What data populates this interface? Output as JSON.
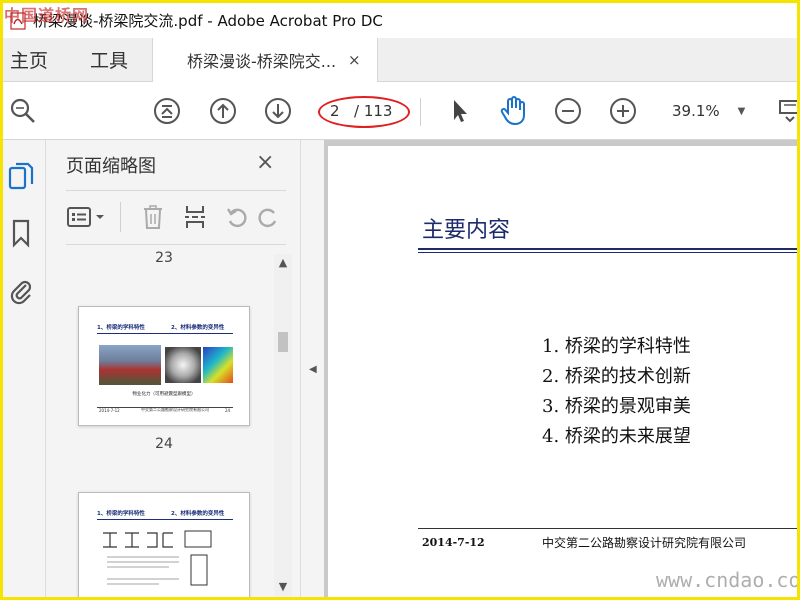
{
  "window": {
    "title": "桥梁漫谈-桥梁院交流.pdf - Adobe Acrobat Pro DC",
    "watermark_top": "中国道桥网"
  },
  "menu": {
    "home": "主页",
    "tools": "工具"
  },
  "tab": {
    "label": "桥梁漫谈-桥梁院交...",
    "close": "×"
  },
  "toolbar": {
    "page_current": "2",
    "page_total": "/ 113",
    "zoom": "39.1%"
  },
  "panel": {
    "title": "页面缩略图",
    "close": "×",
    "thumbs": [
      {
        "page_label": "23"
      },
      {
        "page_label": "24",
        "head_left": "1、桥梁的学科特性",
        "head_right": "2、材料参数的变异性",
        "caption": "物业化力（可用避震型跟模型）",
        "foot_left": "2014-7-12",
        "foot_center": "中交第二公路勘察设计研究院有限公司",
        "foot_right": "24"
      },
      {
        "head_left": "1、桥梁的学科特性",
        "head_right": "2、材料参数的变异性"
      }
    ]
  },
  "document": {
    "heading": "主要内容",
    "items": [
      "1. 桥梁的学科特性",
      "2. 桥梁的技术创新",
      "3. 桥梁的景观审美",
      "4. 桥梁的未来展望"
    ],
    "date": "2014-7-12",
    "organization": "中交第二公路勘察设计研究院有限公司",
    "watermark": "www.cndao.com"
  },
  "colors": {
    "title_blue": "#1d2b6e",
    "highlight_red": "#e02020",
    "frame_yellow": "#f5e400"
  }
}
